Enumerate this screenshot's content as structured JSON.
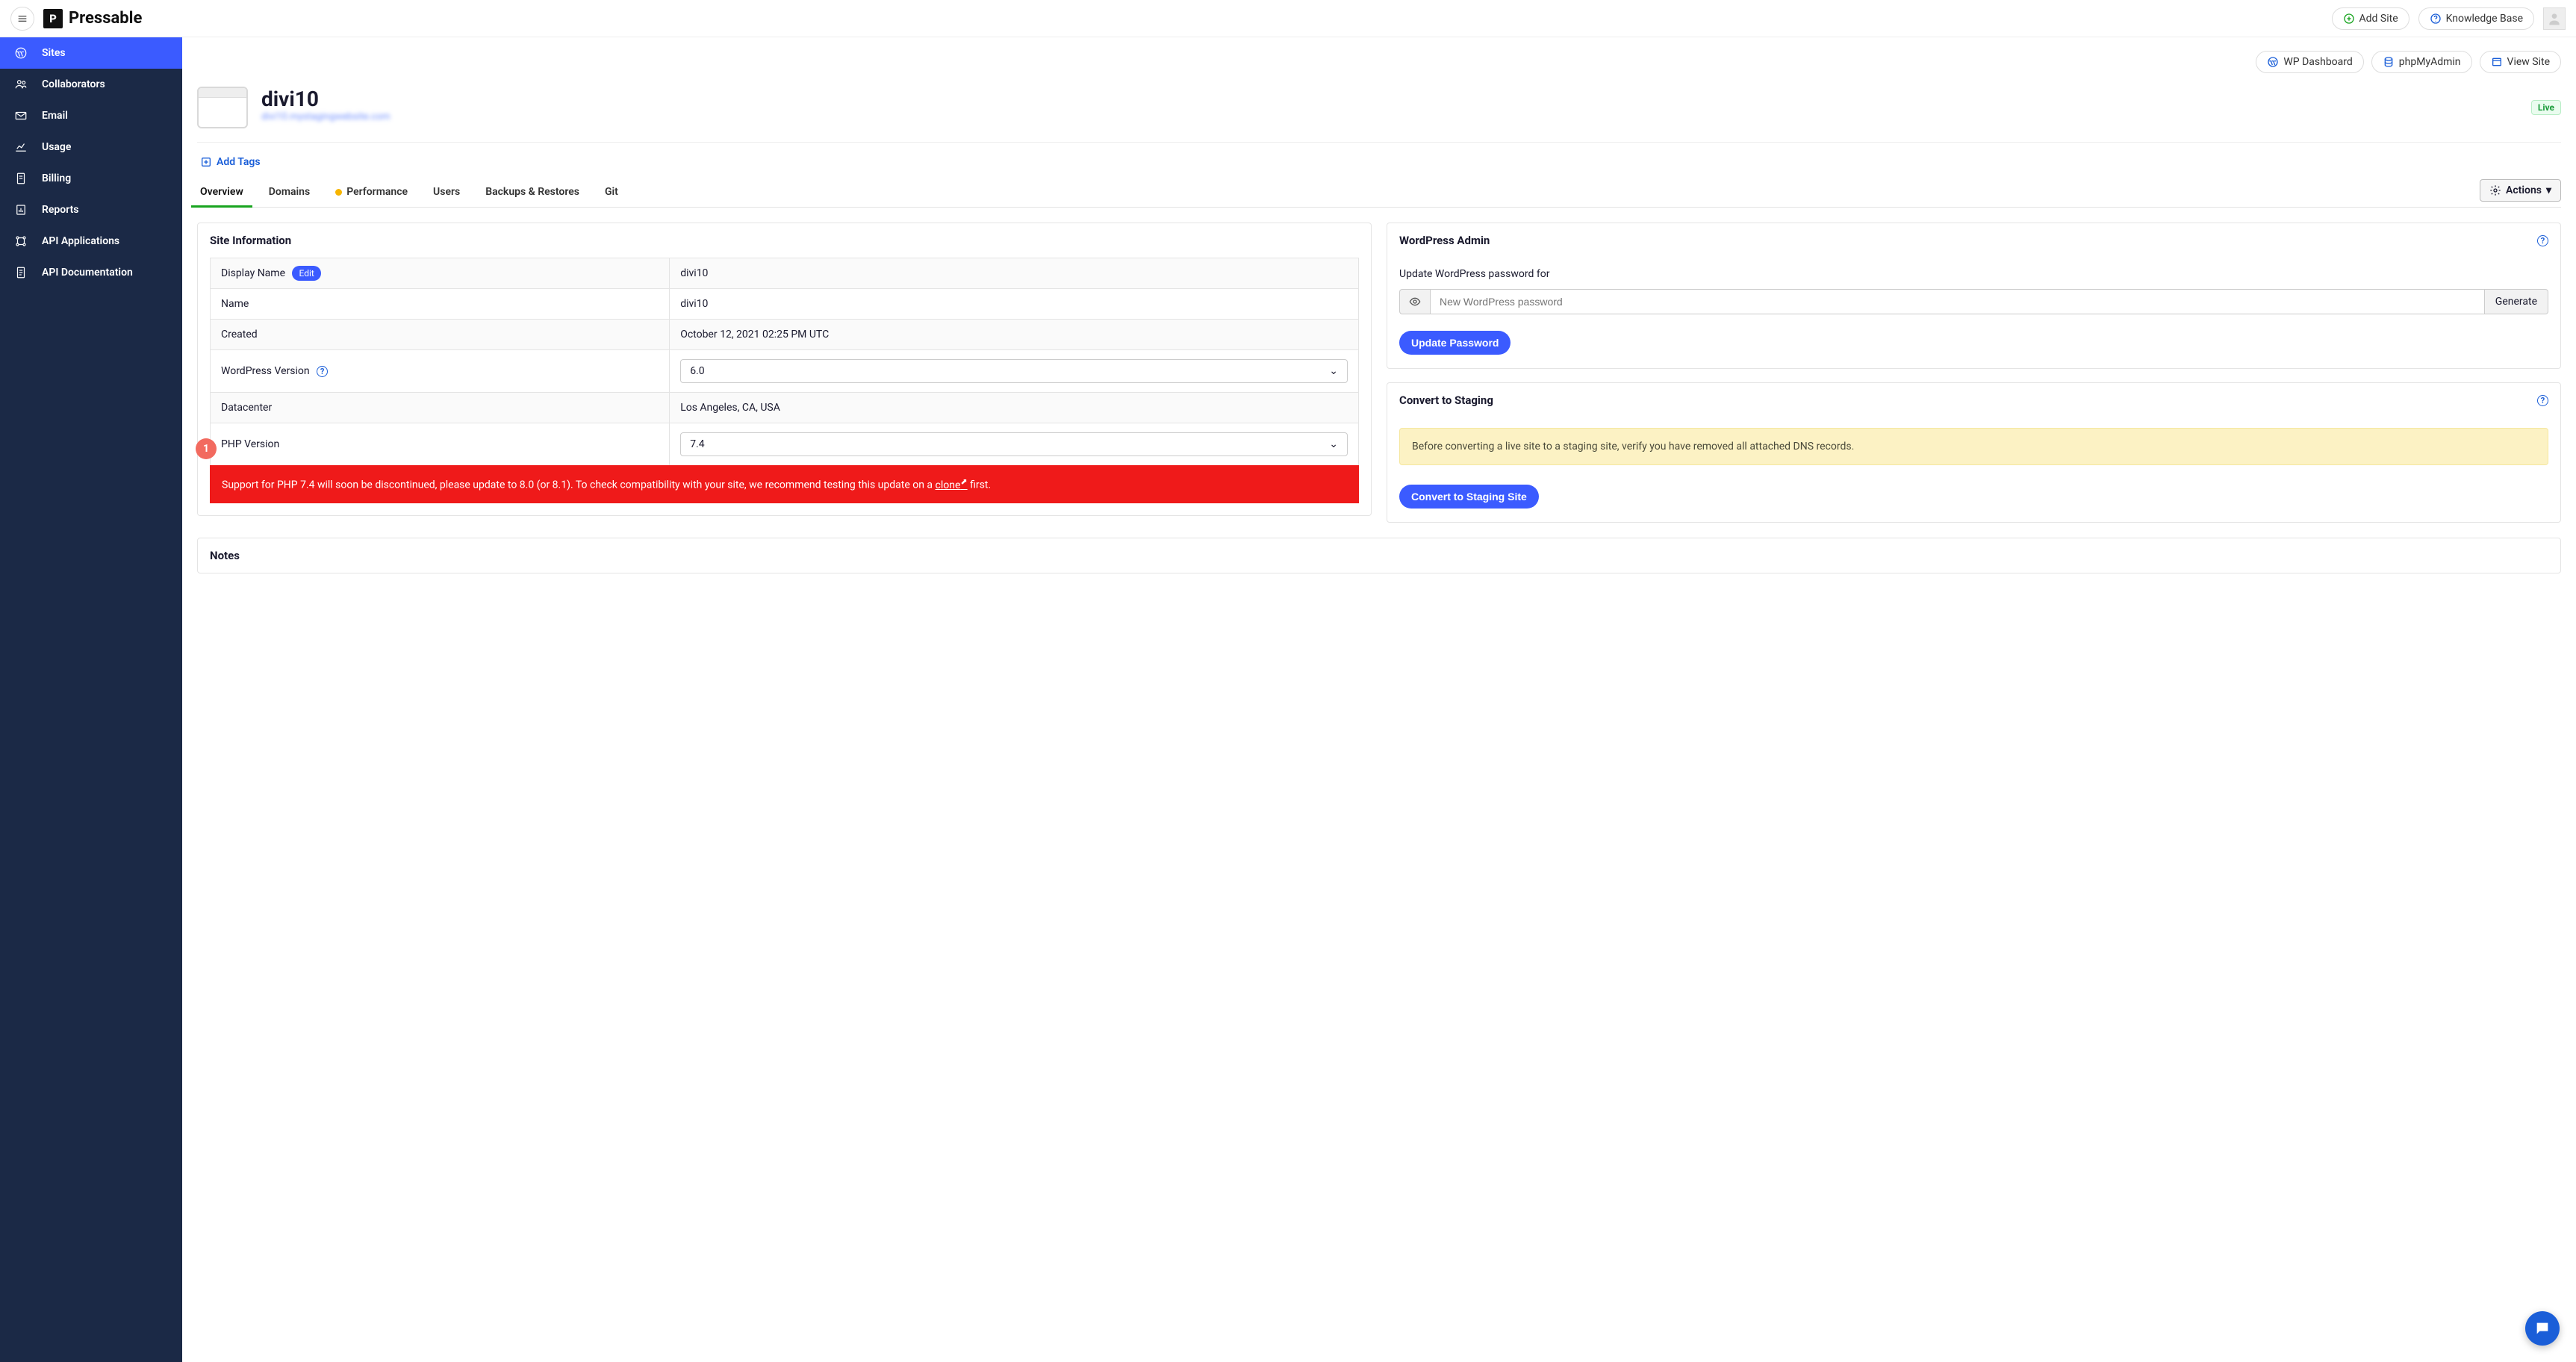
{
  "brand": "Pressable",
  "topbar": {
    "add_site": "Add Site",
    "knowledge_base": "Knowledge Base"
  },
  "sidebar": {
    "items": [
      {
        "label": "Sites"
      },
      {
        "label": "Collaborators"
      },
      {
        "label": "Email"
      },
      {
        "label": "Usage"
      },
      {
        "label": "Billing"
      },
      {
        "label": "Reports"
      },
      {
        "label": "API Applications"
      },
      {
        "label": "API Documentation"
      }
    ]
  },
  "site_actions": {
    "wp_dashboard": "WP Dashboard",
    "phpmyadmin": "phpMyAdmin",
    "view_site": "View Site"
  },
  "site": {
    "title": "divi10",
    "url": "divi10.mystagingwebsite.com",
    "status": "Live"
  },
  "add_tags_label": "Add Tags",
  "tabs": {
    "overview": "Overview",
    "domains": "Domains",
    "performance": "Performance",
    "users": "Users",
    "backups": "Backups & Restores",
    "git": "Git",
    "actions": "Actions"
  },
  "site_info": {
    "heading": "Site Information",
    "display_name_label": "Display Name",
    "edit_label": "Edit",
    "display_name_value": "divi10",
    "name_label": "Name",
    "name_value": "divi10",
    "created_label": "Created",
    "created_value": "October 12, 2021 02:25 PM UTC",
    "wp_version_label": "WordPress Version",
    "wp_version_value": "6.0",
    "datacenter_label": "Datacenter",
    "datacenter_value": "Los Angeles, CA, USA",
    "php_version_label": "PHP Version",
    "php_version_value": "7.4",
    "php_marker": "1",
    "php_alert_pre": "Support for PHP 7.4 will soon be discontinued, please update to 8.0 (or 8.1). To check compatibility with your site, we recommend testing this update on a ",
    "php_alert_link": "clone",
    "php_alert_post": " first."
  },
  "wp_admin": {
    "heading": "WordPress Admin",
    "update_label": "Update WordPress password for",
    "placeholder": "New WordPress password",
    "generate": "Generate",
    "update_btn": "Update Password"
  },
  "staging": {
    "heading": "Convert to Staging",
    "warning": "Before converting a live site to a staging site, verify you have removed all attached DNS records.",
    "btn": "Convert to Staging Site"
  },
  "notes": {
    "heading": "Notes"
  }
}
